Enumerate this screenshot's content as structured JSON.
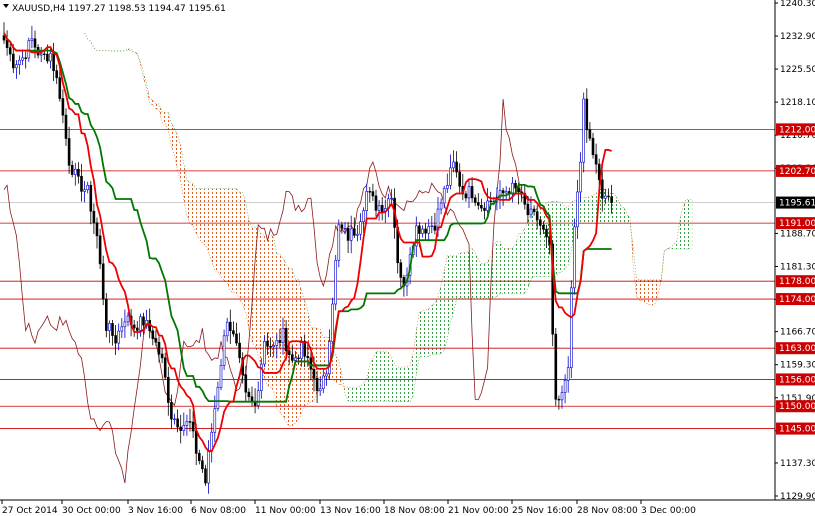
{
  "header": {
    "symbol_line": "XAUUSD,H4  1197.27 1198.53 1194.47 1195.61"
  },
  "chart_data": {
    "type": "candlestick",
    "title": "XAUUSD,H4  1197.27 1198.53 1194.47 1195.61",
    "ylim": [
      1126.0,
      1244.0
    ],
    "y_ticks": [
      "1240.30",
      "1232.90",
      "1225.50",
      "1218.10",
      "1210.70",
      "1203.30",
      "1195.61",
      "1188.70",
      "1181.30",
      "1173.90",
      "1166.70",
      "1159.30",
      "1151.90",
      "1144.50",
      "1137.30",
      "1129.90"
    ],
    "y_tick_values": [
      1240.3,
      1232.9,
      1225.5,
      1218.1,
      1210.7,
      1203.3,
      1195.61,
      1188.7,
      1181.3,
      1173.9,
      1166.7,
      1159.3,
      1151.9,
      1144.5,
      1137.3,
      1129.9
    ],
    "x_labels": [
      "27 Oct 2014",
      "30 Oct 00:00",
      "3 Nov 16:00",
      "6 Nov 08:00",
      "11 Nov 00:00",
      "13 Nov 16:00",
      "18 Nov 08:00",
      "21 Nov 00:00",
      "25 Nov 16:00",
      "28 Nov 08:00",
      "3 Dec 00:00"
    ],
    "levels": [
      "1212.00",
      "1202.70",
      "1191.00",
      "1178.00",
      "1174.00",
      "1163.00",
      "1156.00",
      "1150.00",
      "1145.00"
    ],
    "level_values": [
      1212.0,
      1202.7,
      1191.0,
      1178.0,
      1174.0,
      1163.0,
      1156.0,
      1150.0,
      1145.0
    ],
    "current_price": "1195.61",
    "current_price_value": 1195.61,
    "colors": {
      "background": "#ffffff",
      "axis": "#000000",
      "level_line": "#cc0000",
      "level_label_bg": "#cc0000",
      "level_label_text": "#ffffff",
      "current_price_bg": "#000000",
      "current_price_text": "#ffffff",
      "bull_candle": "#0000cc",
      "bear_candle": "#000000",
      "tenkan": "#ee0000",
      "kijun": "#007700",
      "chikou": "#8b1a1a",
      "cloud_bear": "#e05a1a",
      "cloud_bull": "#2e9e3e"
    },
    "anchors": [
      [
        0,
        1232
      ],
      [
        3,
        1227
      ],
      [
        6,
        1228
      ],
      [
        9,
        1232
      ],
      [
        12,
        1228
      ],
      [
        15,
        1229
      ],
      [
        18,
        1220
      ],
      [
        21,
        1205
      ],
      [
        24,
        1200
      ],
      [
        27,
        1198
      ],
      [
        30,
        1188
      ],
      [
        33,
        1168
      ],
      [
        36,
        1165
      ],
      [
        39,
        1170
      ],
      [
        42,
        1168
      ],
      [
        45,
        1169
      ],
      [
        48,
        1166
      ],
      [
        51,
        1160
      ],
      [
        54,
        1148
      ],
      [
        57,
        1146
      ],
      [
        60,
        1146
      ],
      [
        62,
        1140
      ],
      [
        64,
        1136
      ],
      [
        65,
        1133
      ],
      [
        66,
        1139
      ],
      [
        69,
        1155
      ],
      [
        72,
        1170
      ],
      [
        75,
        1163
      ],
      [
        78,
        1152
      ],
      [
        81,
        1150
      ],
      [
        84,
        1165
      ],
      [
        87,
        1163
      ],
      [
        90,
        1166
      ],
      [
        93,
        1160
      ],
      [
        96,
        1163
      ],
      [
        99,
        1158
      ],
      [
        102,
        1153
      ],
      [
        104,
        1158
      ],
      [
        108,
        1190
      ],
      [
        111,
        1188
      ],
      [
        114,
        1190
      ],
      [
        117,
        1198
      ],
      [
        120,
        1195
      ],
      [
        123,
        1195
      ],
      [
        125,
        1198
      ],
      [
        127,
        1183
      ],
      [
        129,
        1176
      ],
      [
        131,
        1185
      ],
      [
        133,
        1190
      ],
      [
        136,
        1190
      ],
      [
        139,
        1191
      ],
      [
        142,
        1198
      ],
      [
        145,
        1204
      ],
      [
        148,
        1198
      ],
      [
        151,
        1198
      ],
      [
        154,
        1195
      ],
      [
        157,
        1196
      ],
      [
        160,
        1197
      ],
      [
        163,
        1199
      ],
      [
        166,
        1198
      ],
      [
        169,
        1193
      ],
      [
        172,
        1192
      ],
      [
        174,
        1189
      ],
      [
        176,
        1185
      ],
      [
        177,
        1166
      ],
      [
        178,
        1150
      ],
      [
        180,
        1152
      ],
      [
        182,
        1160
      ],
      [
        184,
        1190
      ],
      [
        186,
        1205
      ],
      [
        187,
        1218
      ],
      [
        188,
        1211
      ],
      [
        189,
        1210
      ],
      [
        191,
        1203
      ],
      [
        192,
        1200
      ],
      [
        193,
        1198
      ],
      [
        195,
        1197
      ],
      [
        196,
        1195.61
      ]
    ]
  }
}
